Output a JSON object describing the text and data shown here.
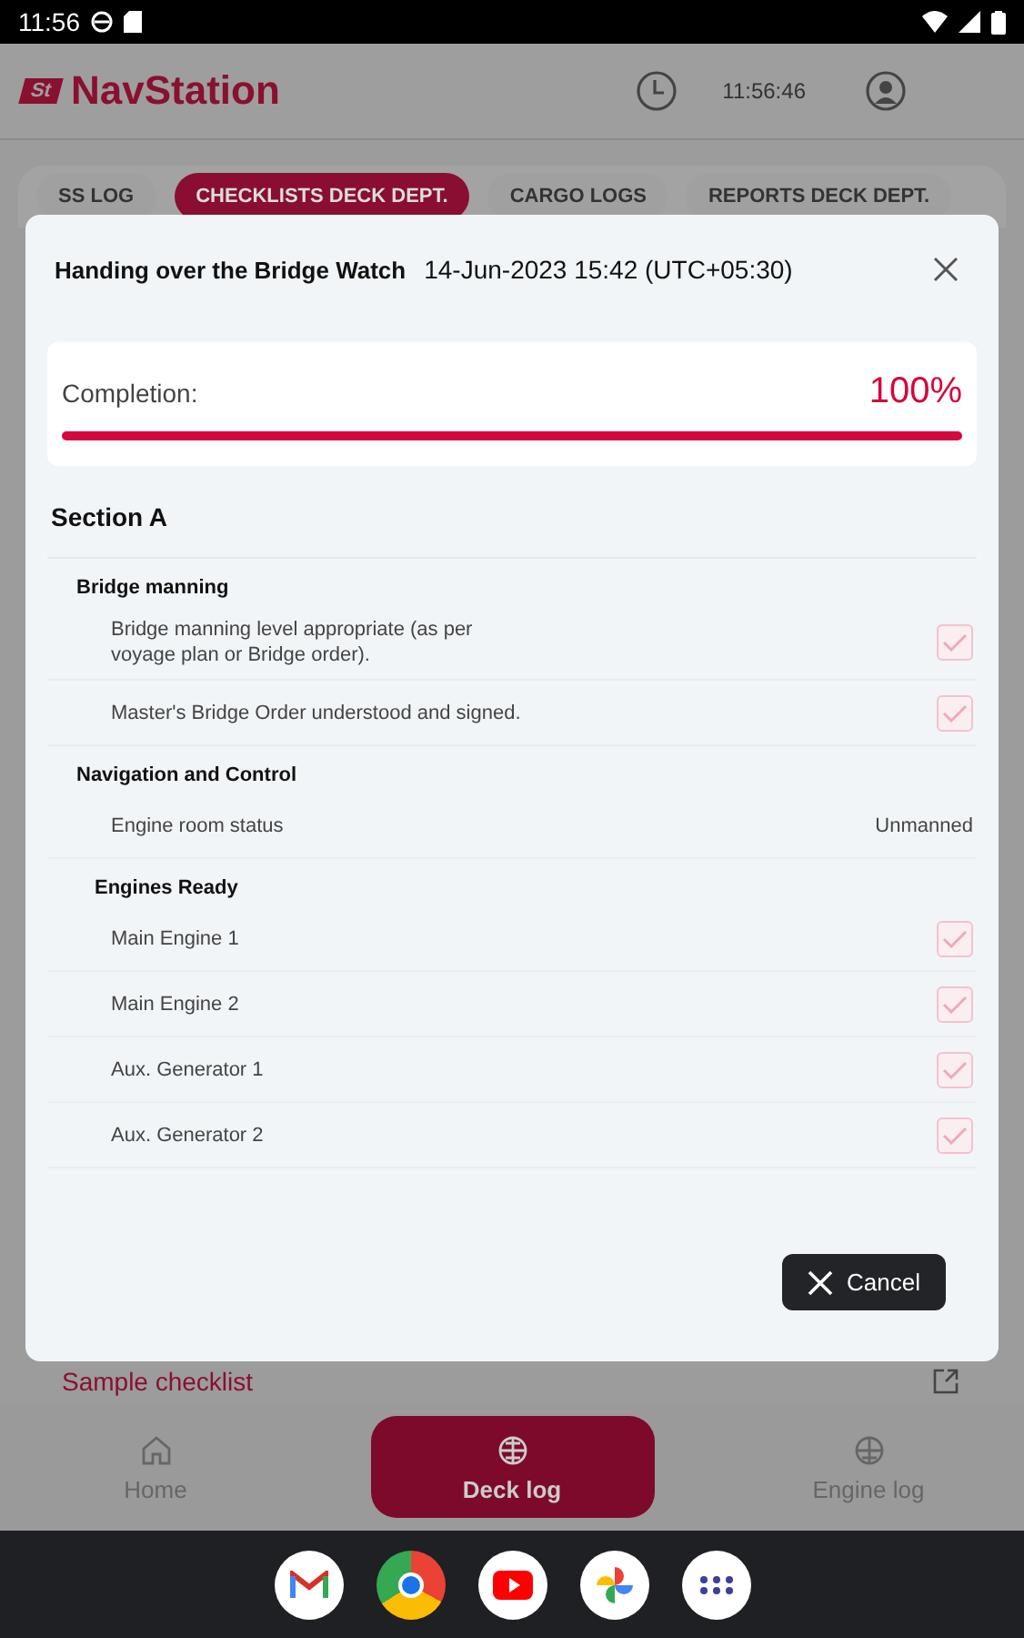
{
  "status_bar": {
    "time": "11:56"
  },
  "app_bar": {
    "logo_mark": "St",
    "title": "NavStation",
    "clock": "11:56:46"
  },
  "tabs": [
    {
      "label": "SS LOG",
      "selected": false
    },
    {
      "label": "CHECKLISTS DECK DEPT.",
      "selected": true
    },
    {
      "label": "CARGO LOGS",
      "selected": false
    },
    {
      "label": "REPORTS DECK DEPT.",
      "selected": false
    }
  ],
  "background_list": [
    {
      "label": "Sample checklist"
    }
  ],
  "dialog": {
    "title": "Handing over the Bridge Watch",
    "timestamp": "14-Jun-2023 15:42 (UTC+05:30)",
    "completion": {
      "label": "Completion:",
      "value": "100%",
      "level": 1
    },
    "sections": [
      {
        "title": "Section A",
        "groups": [
          {
            "title": "Bridge manning",
            "items": [
              {
                "kind": "check",
                "label": "Bridge manning level appropriate (as per voyage plan or Bridge order).",
                "checked": true
              },
              {
                "kind": "check",
                "label": "Master's Bridge Order understood and signed.",
                "checked": true
              }
            ]
          },
          {
            "title": "Navigation and Control",
            "items": [
              {
                "kind": "value",
                "label": "Engine room status",
                "value": "Unmanned"
              }
            ],
            "children": [
              {
                "title": "Engines Ready",
                "items": [
                  {
                    "kind": "check",
                    "label": "Main Engine 1",
                    "checked": true
                  },
                  {
                    "kind": "check",
                    "label": "Main Engine 2",
                    "checked": true
                  },
                  {
                    "kind": "check",
                    "label": "Aux. Generator 1",
                    "checked": true
                  },
                  {
                    "kind": "check",
                    "label": "Aux. Generator 2",
                    "checked": true
                  }
                ]
              }
            ]
          }
        ]
      }
    ],
    "cancel": "Cancel"
  },
  "bottom_nav": [
    {
      "label": "Home",
      "selected": false
    },
    {
      "label": "Deck log",
      "selected": true
    },
    {
      "label": "Engine log",
      "selected": false
    }
  ]
}
